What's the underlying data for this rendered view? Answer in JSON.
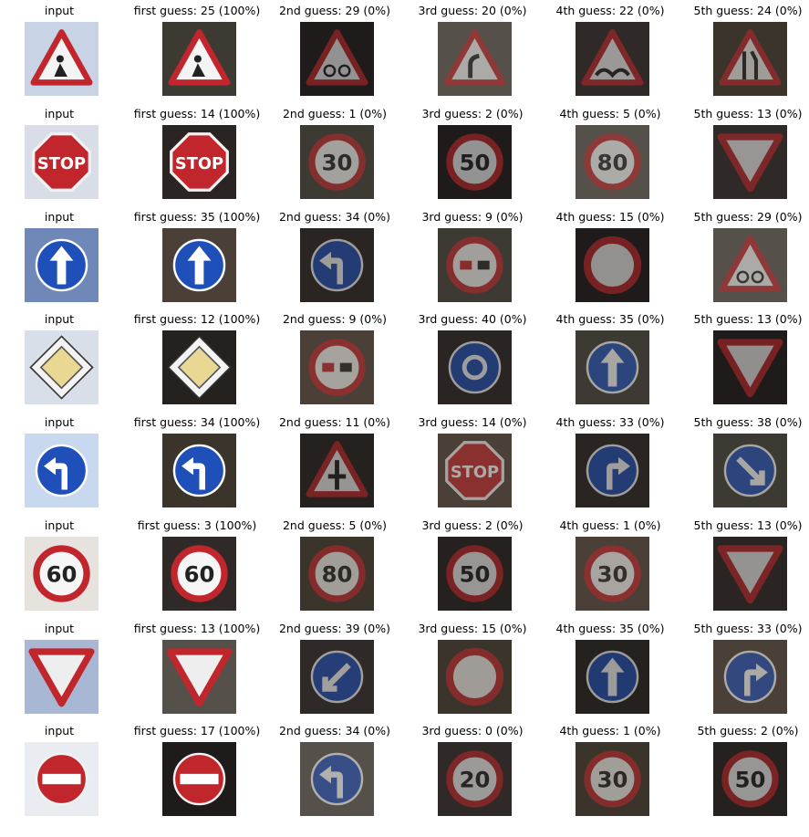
{
  "rows": [
    {
      "input": {
        "label": "input",
        "sign": "roadworks-sign"
      },
      "guesses": [
        {
          "label": "first guess: 25 (100%)",
          "sign": "roadworks-sign"
        },
        {
          "label": "2nd guess: 29 (0%)",
          "sign": "bicycles-crossing-sign"
        },
        {
          "label": "3rd guess: 20 (0%)",
          "sign": "dangerous-curve-right-sign"
        },
        {
          "label": "4th guess: 22 (0%)",
          "sign": "bumpy-road-sign"
        },
        {
          "label": "5th guess: 24 (0%)",
          "sign": "road-narrows-right-sign"
        }
      ]
    },
    {
      "input": {
        "label": "input",
        "sign": "stop-sign"
      },
      "guesses": [
        {
          "label": "first guess: 14 (100%)",
          "sign": "stop-sign"
        },
        {
          "label": "2nd guess: 1 (0%)",
          "sign": "speed-limit-30-sign"
        },
        {
          "label": "3rd guess: 2 (0%)",
          "sign": "speed-limit-50-sign"
        },
        {
          "label": "4th guess: 5 (0%)",
          "sign": "speed-limit-80-sign"
        },
        {
          "label": "5th guess: 13 (0%)",
          "sign": "yield-sign"
        }
      ]
    },
    {
      "input": {
        "label": "input",
        "sign": "ahead-only-sign"
      },
      "guesses": [
        {
          "label": "first guess: 35 (100%)",
          "sign": "ahead-only-sign"
        },
        {
          "label": "2nd guess: 34 (0%)",
          "sign": "turn-left-ahead-sign"
        },
        {
          "label": "3rd guess: 9 (0%)",
          "sign": "no-passing-sign"
        },
        {
          "label": "4th guess: 15 (0%)",
          "sign": "no-vehicles-sign"
        },
        {
          "label": "5th guess: 29 (0%)",
          "sign": "bicycles-crossing-sign"
        }
      ]
    },
    {
      "input": {
        "label": "input",
        "sign": "priority-road-sign"
      },
      "guesses": [
        {
          "label": "first guess: 12 (100%)",
          "sign": "priority-road-sign"
        },
        {
          "label": "2nd guess: 9 (0%)",
          "sign": "no-passing-sign"
        },
        {
          "label": "3rd guess: 40 (0%)",
          "sign": "roundabout-mandatory-sign"
        },
        {
          "label": "4th guess: 35 (0%)",
          "sign": "ahead-only-sign"
        },
        {
          "label": "5th guess: 13 (0%)",
          "sign": "yield-sign"
        }
      ]
    },
    {
      "input": {
        "label": "input",
        "sign": "turn-left-ahead-sign"
      },
      "guesses": [
        {
          "label": "first guess: 34 (100%)",
          "sign": "turn-left-ahead-sign"
        },
        {
          "label": "2nd guess: 11 (0%)",
          "sign": "right-of-way-sign"
        },
        {
          "label": "3rd guess: 14 (0%)",
          "sign": "stop-sign"
        },
        {
          "label": "4th guess: 33 (0%)",
          "sign": "turn-right-ahead-sign"
        },
        {
          "label": "5th guess: 38 (0%)",
          "sign": "keep-right-sign"
        }
      ]
    },
    {
      "input": {
        "label": "input",
        "sign": "speed-limit-60-sign"
      },
      "guesses": [
        {
          "label": "first guess: 3 (100%)",
          "sign": "speed-limit-60-sign"
        },
        {
          "label": "2nd guess: 5 (0%)",
          "sign": "speed-limit-80-sign"
        },
        {
          "label": "3rd guess: 2 (0%)",
          "sign": "speed-limit-50-sign"
        },
        {
          "label": "4th guess: 1 (0%)",
          "sign": "speed-limit-30-sign"
        },
        {
          "label": "5th guess: 13 (0%)",
          "sign": "yield-sign"
        }
      ]
    },
    {
      "input": {
        "label": "input",
        "sign": "yield-sign"
      },
      "guesses": [
        {
          "label": "first guess: 13 (100%)",
          "sign": "yield-sign"
        },
        {
          "label": "2nd guess: 39 (0%)",
          "sign": "keep-left-sign"
        },
        {
          "label": "3rd guess: 15 (0%)",
          "sign": "no-vehicles-sign"
        },
        {
          "label": "4th guess: 35 (0%)",
          "sign": "ahead-only-sign"
        },
        {
          "label": "5th guess: 33 (0%)",
          "sign": "turn-right-ahead-sign"
        }
      ]
    },
    {
      "input": {
        "label": "input",
        "sign": "no-entry-sign"
      },
      "guesses": [
        {
          "label": "first guess: 17 (100%)",
          "sign": "no-entry-sign"
        },
        {
          "label": "2nd guess: 34 (0%)",
          "sign": "turn-left-ahead-sign"
        },
        {
          "label": "3rd guess: 0 (0%)",
          "sign": "speed-limit-20-sign"
        },
        {
          "label": "4th guess: 1 (0%)",
          "sign": "speed-limit-30-sign"
        },
        {
          "label": "5th guess: 2 (0%)",
          "sign": "speed-limit-50-sign"
        }
      ]
    }
  ],
  "colors": {
    "sign_red": "#c0262b",
    "sign_blue": "#1f4fb8",
    "sign_yellow": "#e8d893"
  }
}
